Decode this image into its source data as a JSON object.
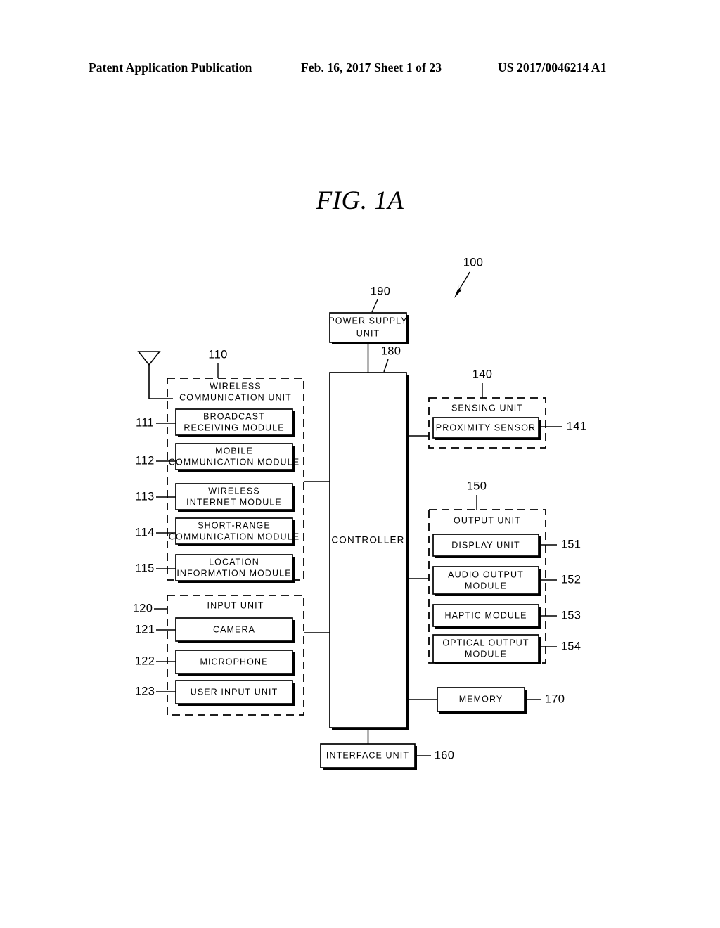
{
  "header": {
    "publication": "Patent Application Publication",
    "date_sheet": "Feb. 16, 2017  Sheet 1 of 23",
    "patent_number": "US 2017/0046214 A1"
  },
  "figure": {
    "title": "FIG. 1A",
    "device_ref": "100"
  },
  "blocks": {
    "power_supply": {
      "label": "POWER SUPPLY UNIT",
      "line1": "POWER SUPPLY",
      "line2": "UNIT",
      "ref": "190"
    },
    "controller": {
      "label": "CONTROLLER",
      "ref": "180"
    },
    "interface": {
      "label": "INTERFACE UNIT",
      "ref": "160"
    },
    "memory": {
      "label": "MEMORY",
      "ref": "170"
    }
  },
  "wireless_unit": {
    "title_line1": "WIRELESS",
    "title_line2": "COMMUNICATION UNIT",
    "ref": "110",
    "modules": [
      {
        "ref": "111",
        "line1": "BROADCAST",
        "line2": "RECEIVING MODULE"
      },
      {
        "ref": "112",
        "line1": "MOBILE",
        "line2": "COMMUNICATION MODULE"
      },
      {
        "ref": "113",
        "line1": "WIRELESS",
        "line2": "INTERNET MODULE"
      },
      {
        "ref": "114",
        "line1": "SHORT-RANGE",
        "line2": "COMMUNICATION MODULE"
      },
      {
        "ref": "115",
        "line1": "LOCATION",
        "line2": "INFORMATION MODULE"
      }
    ]
  },
  "input_unit": {
    "title": "INPUT UNIT",
    "ref": "120",
    "modules": [
      {
        "ref": "121",
        "line1": "CAMERA",
        "line2": ""
      },
      {
        "ref": "122",
        "line1": "MICROPHONE",
        "line2": ""
      },
      {
        "ref": "123",
        "line1": "USER INPUT UNIT",
        "line2": ""
      }
    ]
  },
  "sensing_unit": {
    "title": "SENSING UNIT",
    "ref": "140",
    "modules": [
      {
        "ref": "141",
        "line1": "PROXIMITY SENSOR",
        "line2": ""
      }
    ]
  },
  "output_unit": {
    "title": "OUTPUT UNIT",
    "ref": "150",
    "modules": [
      {
        "ref": "151",
        "line1": "DISPLAY UNIT",
        "line2": ""
      },
      {
        "ref": "152",
        "line1": "AUDIO OUTPUT",
        "line2": "MODULE"
      },
      {
        "ref": "153",
        "line1": "HAPTIC MODULE",
        "line2": ""
      },
      {
        "ref": "154",
        "line1": "OPTICAL OUTPUT",
        "line2": "MODULE"
      }
    ]
  },
  "icons": {
    "antenna": "antenna-icon"
  }
}
